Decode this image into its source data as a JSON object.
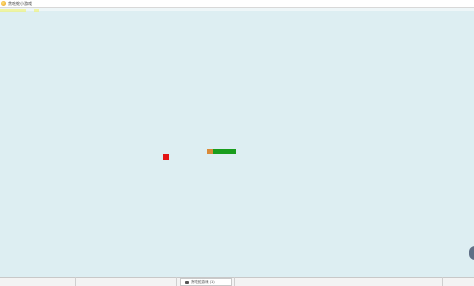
{
  "window": {
    "title": "贪吃蛇小游戏",
    "app_icon": "app-icon",
    "background_color": "#ddeef2"
  },
  "canvas": {
    "food_color": "#e31414",
    "snake_head_color": "#d98a39",
    "snake_body_color": "#199d1d"
  },
  "taskbar": {
    "task_label": "贪吃蛇游戏 (1)",
    "task_icon": "window-icon"
  }
}
